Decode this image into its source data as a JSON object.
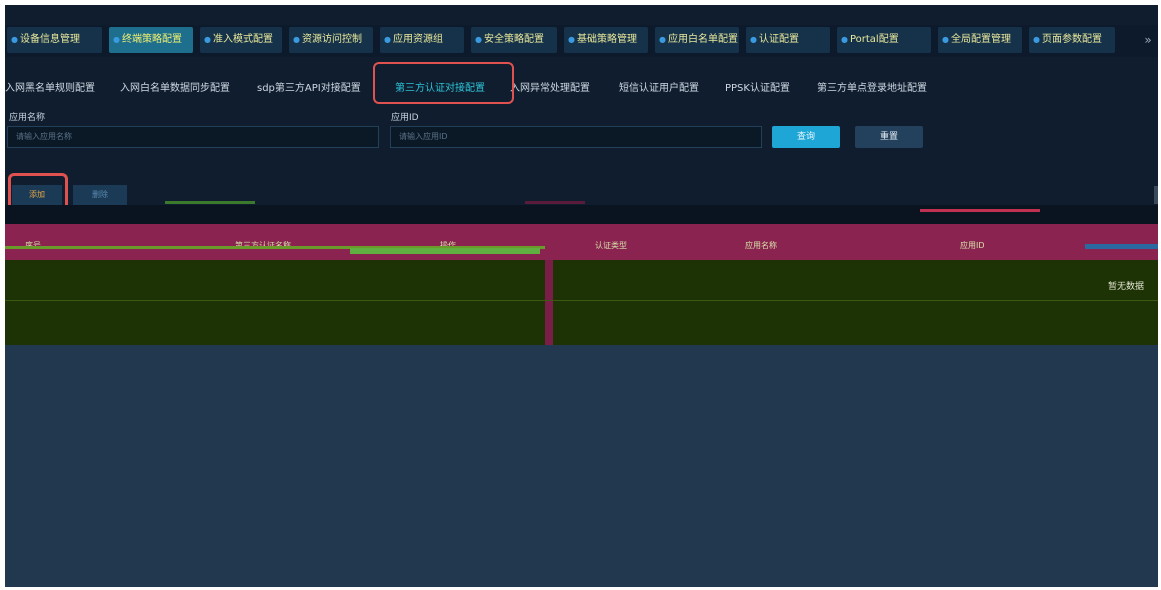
{
  "top_tabs": [
    {
      "label": "设备信息管理"
    },
    {
      "label": "终端策略配置",
      "active": true
    },
    {
      "label": "准入模式配置"
    },
    {
      "label": "资源访问控制"
    },
    {
      "label": "应用资源组"
    },
    {
      "label": "安全策略配置"
    },
    {
      "label": "基础策略管理"
    },
    {
      "label": "应用白名单配置"
    },
    {
      "label": "认证配置"
    },
    {
      "label": "Portal配置"
    },
    {
      "label": "全局配置管理"
    },
    {
      "label": "页面参数配置"
    }
  ],
  "top_more": "»",
  "sub_tabs": [
    {
      "label": "入网黑名单规则配置"
    },
    {
      "label": "入网白名单数据同步配置"
    },
    {
      "label": "sdp第三方API对接配置"
    },
    {
      "label": "第三方认证对接配置",
      "active": true
    },
    {
      "label": "入网异常处理配置"
    },
    {
      "label": "短信认证用户配置"
    },
    {
      "label": "PPSK认证配置"
    },
    {
      "label": "第三方单点登录地址配置"
    }
  ],
  "form": {
    "app_name_label": "应用名称",
    "app_name_placeholder": "请输入应用名称",
    "app_id_label": "应用ID",
    "app_id_placeholder": "请输入应用ID",
    "query_label": "查询",
    "reset_label": "重置"
  },
  "actions": {
    "add_label": "添加",
    "delete_label": "删除"
  },
  "table": {
    "columns": [
      "序号",
      "第三方认证名称",
      "操作",
      "认证类型",
      "应用名称",
      "应用ID"
    ],
    "empty_text": "暂无数据"
  },
  "colors": {
    "accent": "#2ec4d8",
    "highlight": "#e0524f",
    "header_glitch": "#8a2350",
    "body_glitch": "#1d3205"
  }
}
